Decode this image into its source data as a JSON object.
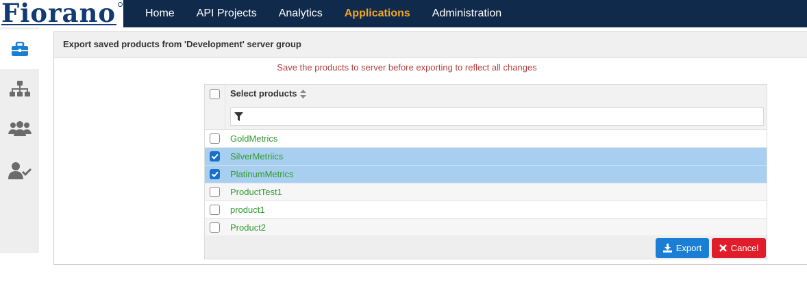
{
  "brand": {
    "logo_text": "Fiorano"
  },
  "nav": {
    "items": [
      {
        "label": "Home"
      },
      {
        "label": "API Projects"
      },
      {
        "label": "Analytics"
      },
      {
        "label": "Applications"
      },
      {
        "label": "Administration"
      }
    ],
    "active": "Applications",
    "active_color": "#f5a623"
  },
  "sidebar": {
    "items": [
      {
        "icon": "briefcase-icon",
        "active": true
      },
      {
        "icon": "sitemap-icon",
        "active": false
      },
      {
        "icon": "users-icon",
        "active": false
      },
      {
        "icon": "user-check-icon",
        "active": false
      }
    ]
  },
  "panel": {
    "title": "Export saved products from 'Development' server group",
    "warning": "Save the products to server before exporting to reflect all changes"
  },
  "grid": {
    "header": "Select products",
    "filter_icon": "filter-icon",
    "sort_icon": "sort-icon",
    "rows": [
      {
        "name": "GoldMetrics",
        "checked": false
      },
      {
        "name": "SilverMetriics",
        "checked": true
      },
      {
        "name": "PlatinumMetrics",
        "checked": true
      },
      {
        "name": "ProductTest1",
        "checked": false
      },
      {
        "name": "product1",
        "checked": false
      },
      {
        "name": "Product2",
        "checked": false
      }
    ]
  },
  "actions": {
    "export_label": "Export",
    "cancel_label": "Cancel",
    "export_color": "#1a7fd4",
    "cancel_color": "#e01e2b"
  }
}
